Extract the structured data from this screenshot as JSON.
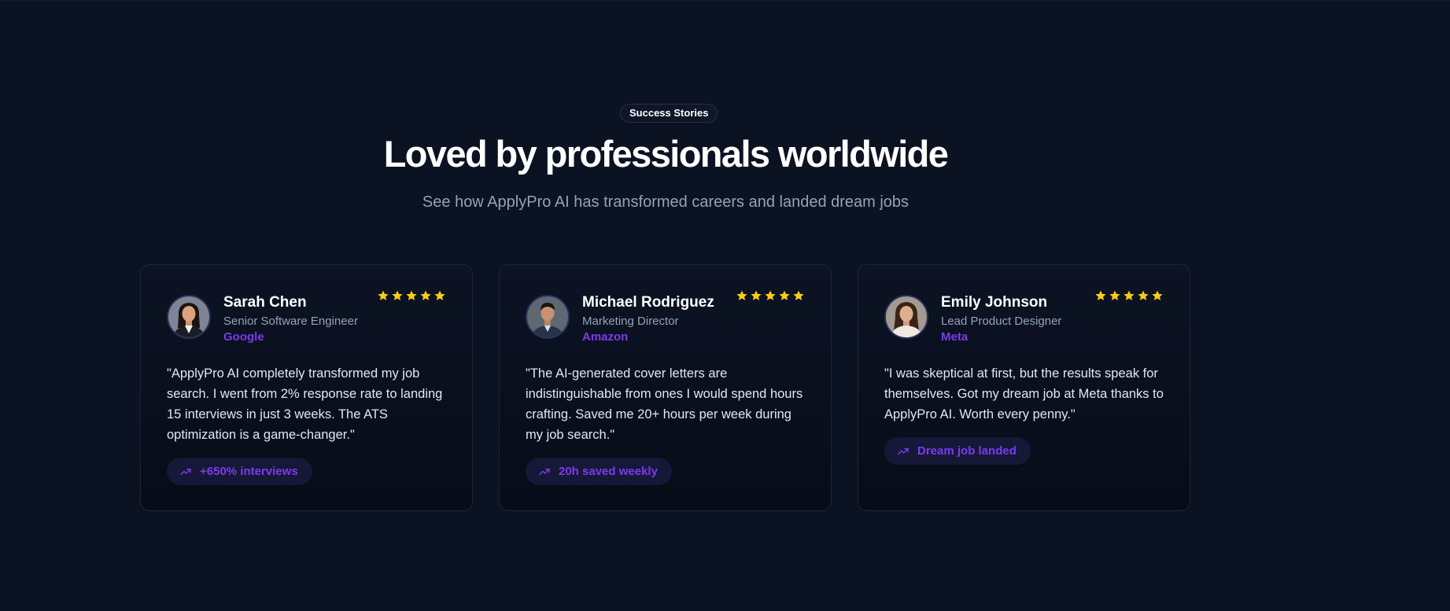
{
  "section": {
    "badge": "Success Stories",
    "title": "Loved by professionals worldwide",
    "subtitle": "See how ApplyPro AI has transformed careers and landed dream jobs"
  },
  "colors": {
    "background": "#0b1221",
    "accent": "#7c3aed",
    "star": "#facc15",
    "muted_text": "#94a3b8"
  },
  "testimonials": [
    {
      "name": "Sarah Chen",
      "role": "Senior Software Engineer",
      "company": "Google",
      "rating": 5,
      "quote": "\"ApplyPro AI completely transformed my job search. I went from 2% response rate to landing 15 interviews in just 3 weeks. The ATS optimization is a game-changer.\"",
      "result": "+650% interviews",
      "result_icon": "trending-up-icon"
    },
    {
      "name": "Michael Rodriguez",
      "role": "Marketing Director",
      "company": "Amazon",
      "rating": 5,
      "quote": "\"The AI-generated cover letters are indistinguishable from ones I would spend hours crafting. Saved me 20+ hours per week during my job search.\"",
      "result": "20h saved weekly",
      "result_icon": "trending-up-icon"
    },
    {
      "name": "Emily Johnson",
      "role": "Lead Product Designer",
      "company": "Meta",
      "rating": 5,
      "quote": "\"I was skeptical at first, but the results speak for themselves. Got my dream job at Meta thanks to ApplyPro AI. Worth every penny.\"",
      "result": "Dream job landed",
      "result_icon": "trending-up-icon"
    }
  ]
}
